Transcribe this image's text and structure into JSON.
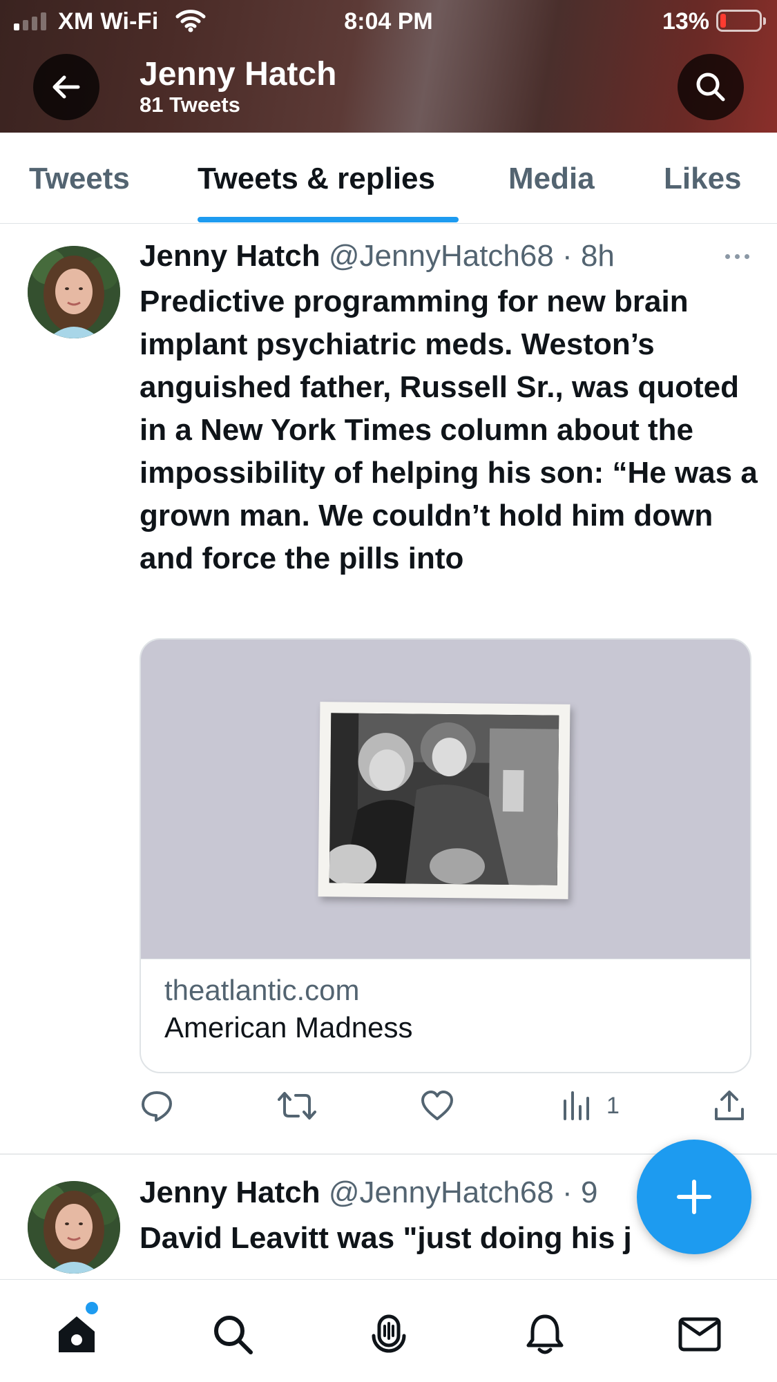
{
  "status_bar": {
    "carrier": "XM Wi-Fi",
    "time": "8:04 PM",
    "battery": "13%",
    "battery_level": 0.13
  },
  "header": {
    "name": "Jenny Hatch",
    "tweet_count": "81 Tweets",
    "back_icon": "arrow-left-icon",
    "search_icon": "search-icon"
  },
  "tabs": [
    {
      "label": "Tweets"
    },
    {
      "label": "Tweets & replies"
    },
    {
      "label": "Media"
    },
    {
      "label": "Likes"
    }
  ],
  "active_tab": "Tweets & replies",
  "tweets": [
    {
      "name": "Jenny Hatch",
      "handle_time": "@JennyHatch68 · 8h",
      "text": "Predictive programming for new brain implant psychiatric meds. Weston’s anguished father, Russell Sr., was quoted in a New York Times column about the impossibility of helping his son: “He was a grown man. We couldn’t hold him down and force the pills into",
      "card": {
        "domain": "theatlantic.com",
        "title": "American Madness"
      },
      "actions": {
        "views": "1"
      }
    },
    {
      "name": "Jenny Hatch",
      "handle_time": "@JennyHatch68 · 9",
      "text": "David Leavitt was \"just doing his j"
    }
  ],
  "colors": {
    "accent": "#1d9bf0",
    "secondary_text": "#536471",
    "primary_text": "#0f1419"
  }
}
